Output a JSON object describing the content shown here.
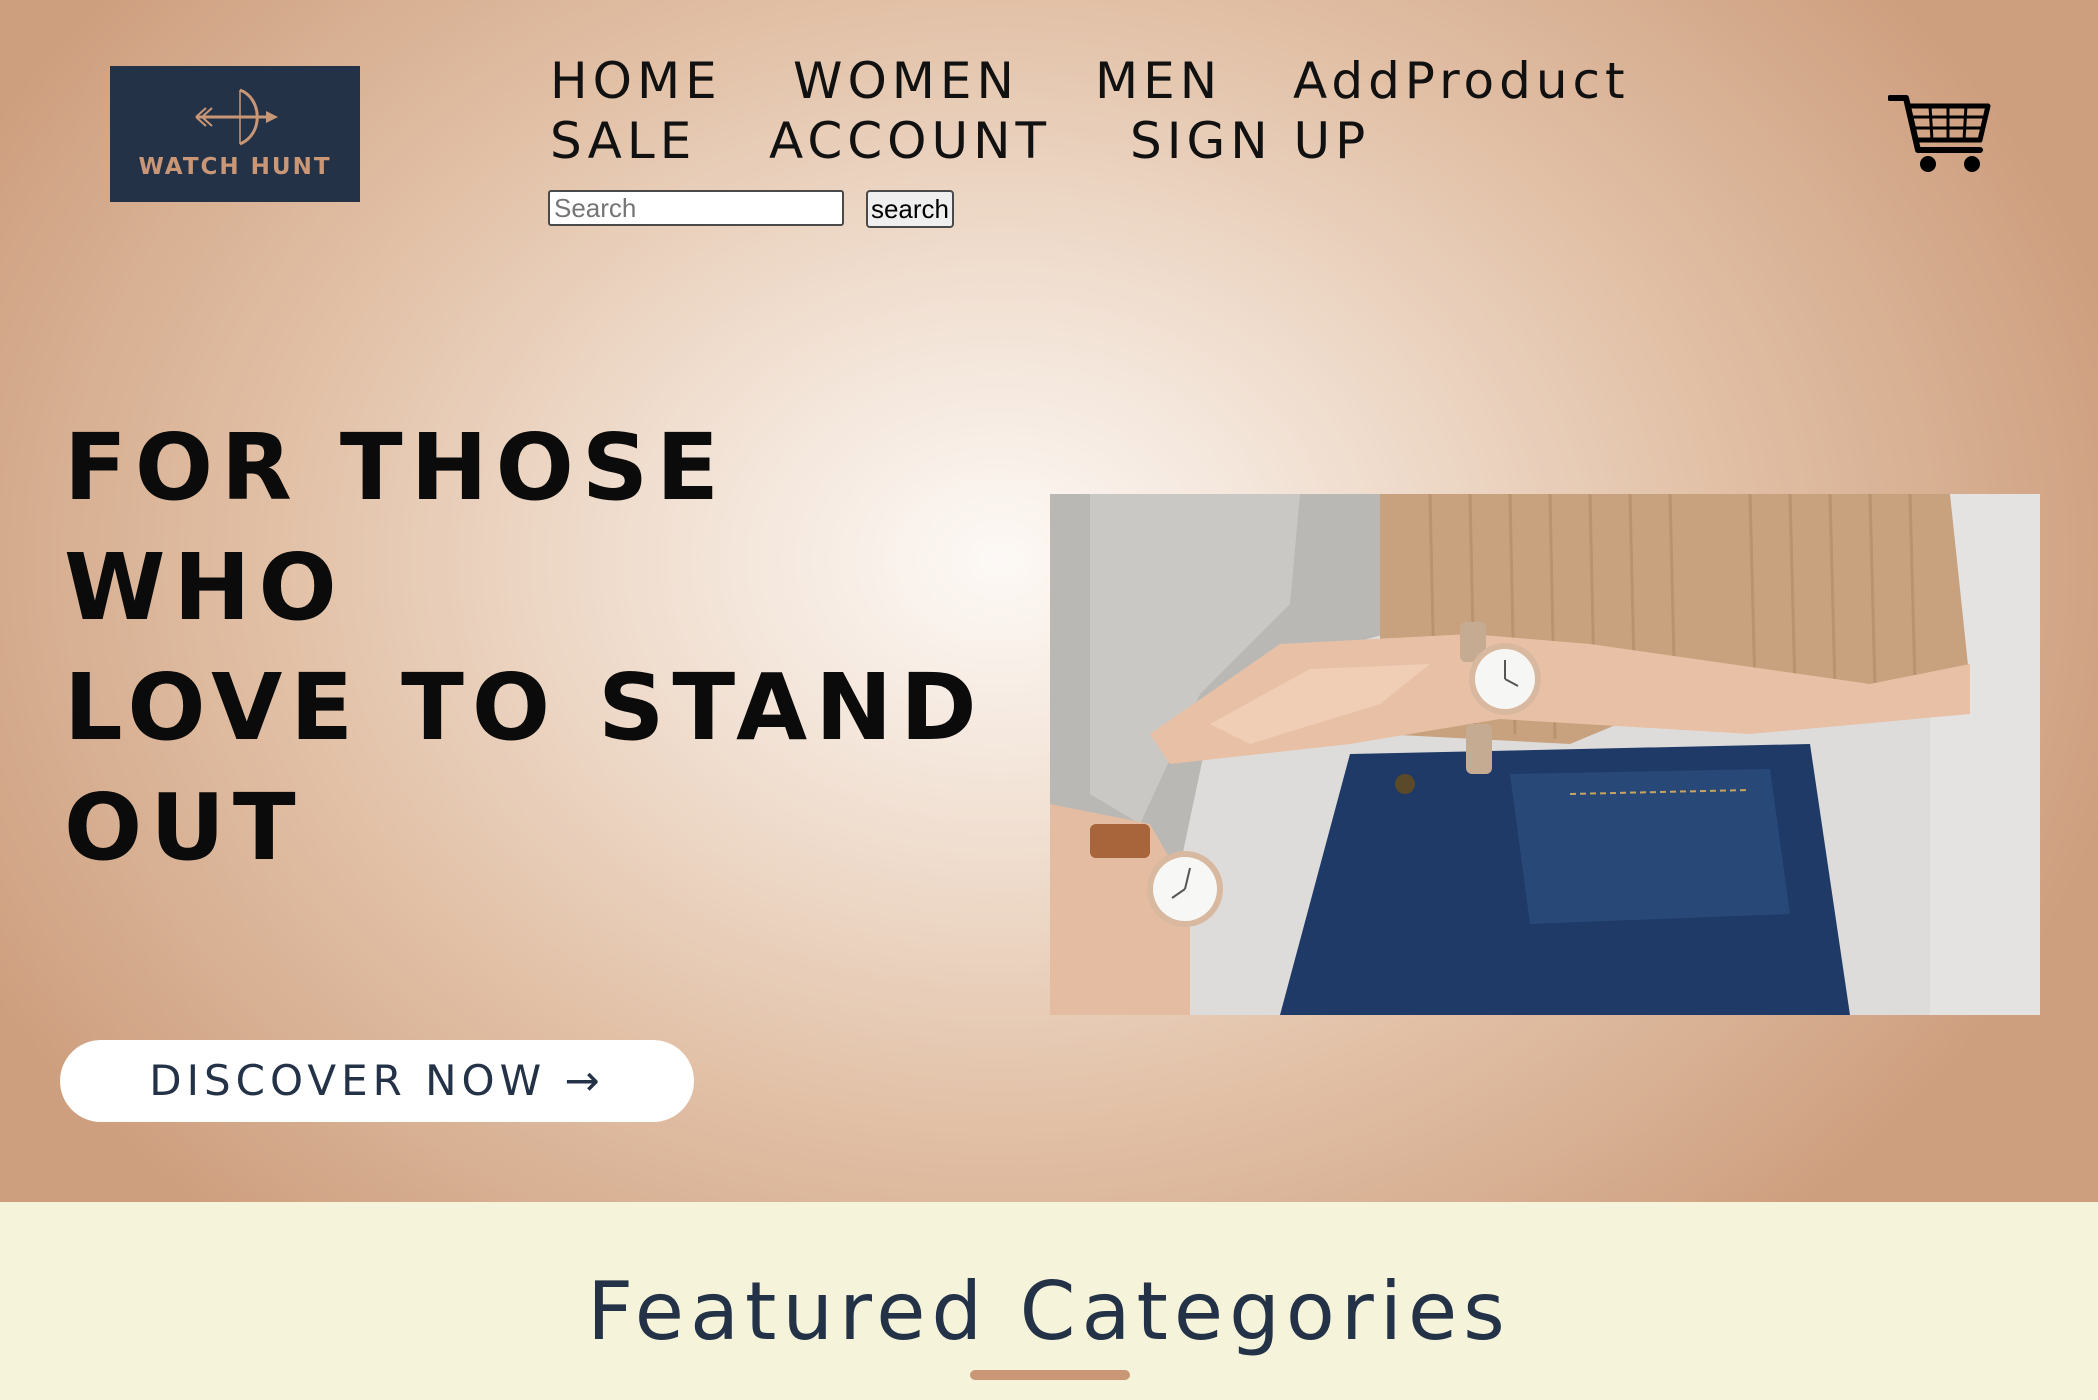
{
  "brand": {
    "name": "WATCH HUNT",
    "logo_icon": "bow-and-arrow-icon",
    "logo_bg": "#243248",
    "logo_accent": "#c99776"
  },
  "nav": {
    "items": [
      {
        "label": "HOME"
      },
      {
        "label": "WOMEN"
      },
      {
        "label": "MEN"
      },
      {
        "label": "AddProduct"
      },
      {
        "label": "SALE"
      },
      {
        "label": "ACCOUNT"
      },
      {
        "label": "SIGN UP"
      }
    ]
  },
  "search": {
    "placeholder": "Search",
    "value": "",
    "button_label": "search"
  },
  "cart": {
    "icon": "shopping-cart-icon"
  },
  "hero": {
    "headline_lines": [
      "FOR THOSE",
      "WHO",
      "LOVE TO STAND",
      "OUT"
    ],
    "cta_label": "DISCOVER NOW →",
    "image_subject": "two-people-wearing-watches"
  },
  "featured": {
    "title": "Featured Categories"
  },
  "colors": {
    "hero_center": "#fdf9f6",
    "hero_edge": "#ce9f7f",
    "section_bg": "#f5f4db",
    "heading_navy": "#243248",
    "accent_tan": "#c99776"
  }
}
